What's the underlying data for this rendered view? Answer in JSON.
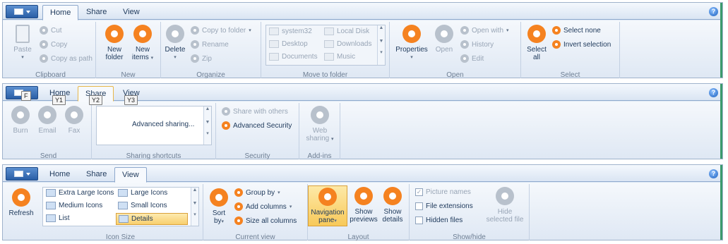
{
  "colors": {
    "accent": "#f58220",
    "disabled": "#b8c1cc",
    "highlight": "#f8c95a"
  },
  "help_glyph": "?",
  "home_ribbon": {
    "tabs": [
      "Home",
      "Share",
      "View"
    ],
    "clipboard": {
      "label": "Clipboard",
      "paste": "Paste",
      "cut": "Cut",
      "copy": "Copy",
      "copy_as_path": "Copy as path"
    },
    "new": {
      "label": "New",
      "new_folder": [
        "New",
        "folder"
      ],
      "new_items": [
        "New",
        "items"
      ]
    },
    "organize": {
      "label": "Organize",
      "delete": "Delete",
      "copy_to_folder": "Copy to folder",
      "rename": "Rename",
      "zip": "Zip"
    },
    "move_to_folder": {
      "label": "Move to folder",
      "items": [
        "system32",
        "Local Disk",
        "Desktop",
        "Downloads",
        "Documents",
        "Music"
      ]
    },
    "open": {
      "label": "Open",
      "properties": "Properties",
      "open": "Open",
      "open_with": "Open with",
      "history": "History",
      "edit": "Edit"
    },
    "select": {
      "label": "Select",
      "select_all": [
        "Select",
        "all"
      ],
      "select_none": "Select none",
      "invert_selection": "Invert selection"
    }
  },
  "share_ribbon": {
    "tabs": [
      "Home",
      "Share",
      "View"
    ],
    "keytips": {
      "file": "F",
      "home": "Y1",
      "share": "Y2",
      "view": "Y3"
    },
    "send": {
      "label": "Send",
      "burn": "Burn",
      "email": "Email",
      "fax": "Fax"
    },
    "sharing_shortcuts": {
      "label": "Sharing shortcuts",
      "advanced_sharing": "Advanced sharing..."
    },
    "security": {
      "label": "Security",
      "share_with_others": "Share with others",
      "advanced_security": "Advanced Security"
    },
    "addins": {
      "label": "Add-ins",
      "web_sharing": [
        "Web",
        "sharing"
      ]
    }
  },
  "view_ribbon": {
    "tabs": [
      "Home",
      "Share",
      "View"
    ],
    "refresh": "Refresh",
    "icon_size": {
      "label": "Icon Size",
      "items": [
        "Extra Large Icons",
        "Large Icons",
        "Medium Icons",
        "Small Icons",
        "List",
        "Details"
      ]
    },
    "current_view": {
      "label": "Current view",
      "sort_by": [
        "Sort",
        "by"
      ],
      "group_by": "Group by",
      "add_columns": "Add columns",
      "size_all_columns": "Size all columns"
    },
    "layout": {
      "label": "Layout",
      "navigation_pane": [
        "Navigation",
        "pane"
      ],
      "show_previews": [
        "Show",
        "previews"
      ],
      "show_details": [
        "Show",
        "details"
      ]
    },
    "show_hide": {
      "label": "Show/hide",
      "picture_names": "Picture names",
      "file_extensions": "File extensions",
      "hidden_files": "Hidden files",
      "hide_selected_file": [
        "Hide",
        "selected file"
      ]
    }
  }
}
